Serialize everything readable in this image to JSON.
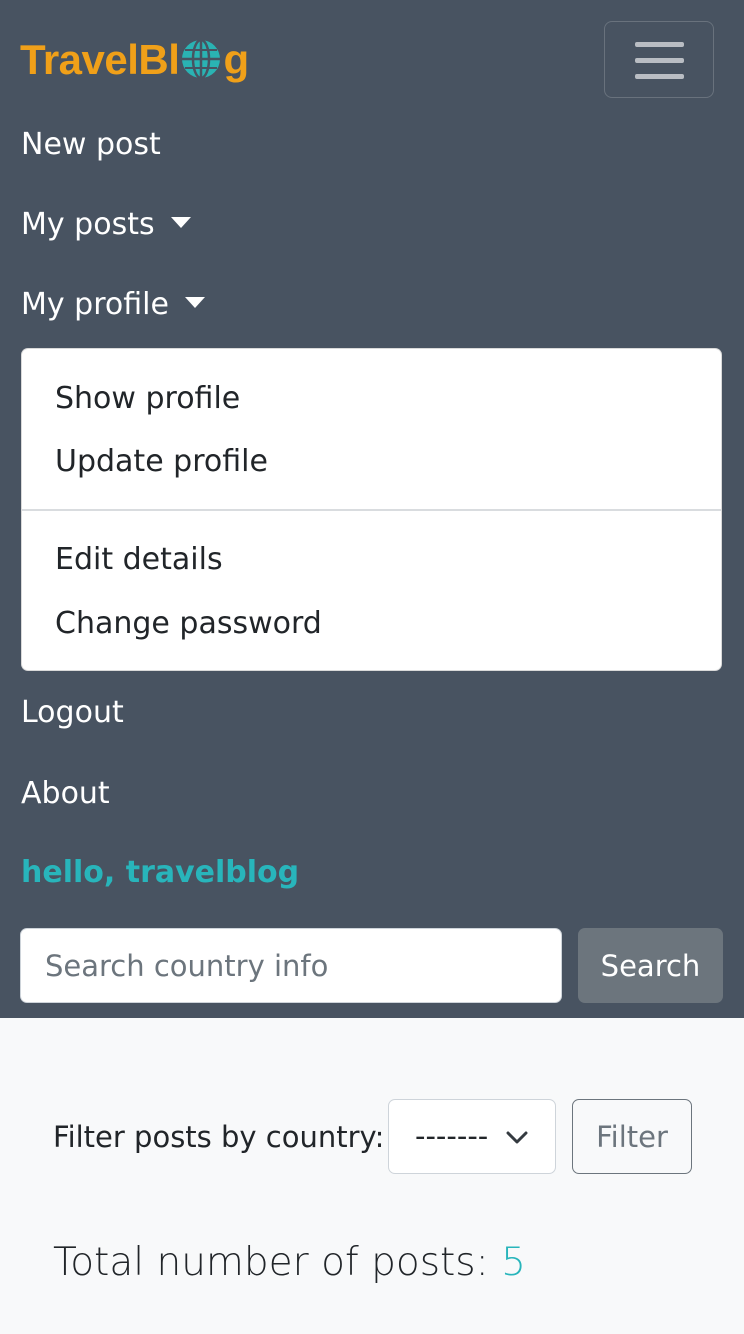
{
  "brand": {
    "prefix": "TravelBl",
    "suffix": "g",
    "color": "#f0a019",
    "globe_icon": "globe-icon"
  },
  "navbar": {
    "background": "#485361",
    "toggler_icon": "hamburger-menu-icon",
    "links": {
      "new_post": "New post",
      "my_posts": "My posts",
      "my_profile": "My profile",
      "logout": "Logout",
      "about": "About"
    },
    "greeting": "hello, travelblog",
    "greeting_color": "#28b5bb"
  },
  "profile_dropdown": {
    "items": {
      "show_profile": "Show profile",
      "update_profile": "Update profile",
      "edit_details": "Edit details",
      "change_password": "Change password"
    }
  },
  "search": {
    "placeholder": "Search country info",
    "value": "",
    "button_label": "Search"
  },
  "filter": {
    "label": "Filter posts by country:",
    "selected": "---------",
    "button_label": "Filter"
  },
  "stats": {
    "total_label": "Total number of posts:",
    "total_value": "5"
  }
}
